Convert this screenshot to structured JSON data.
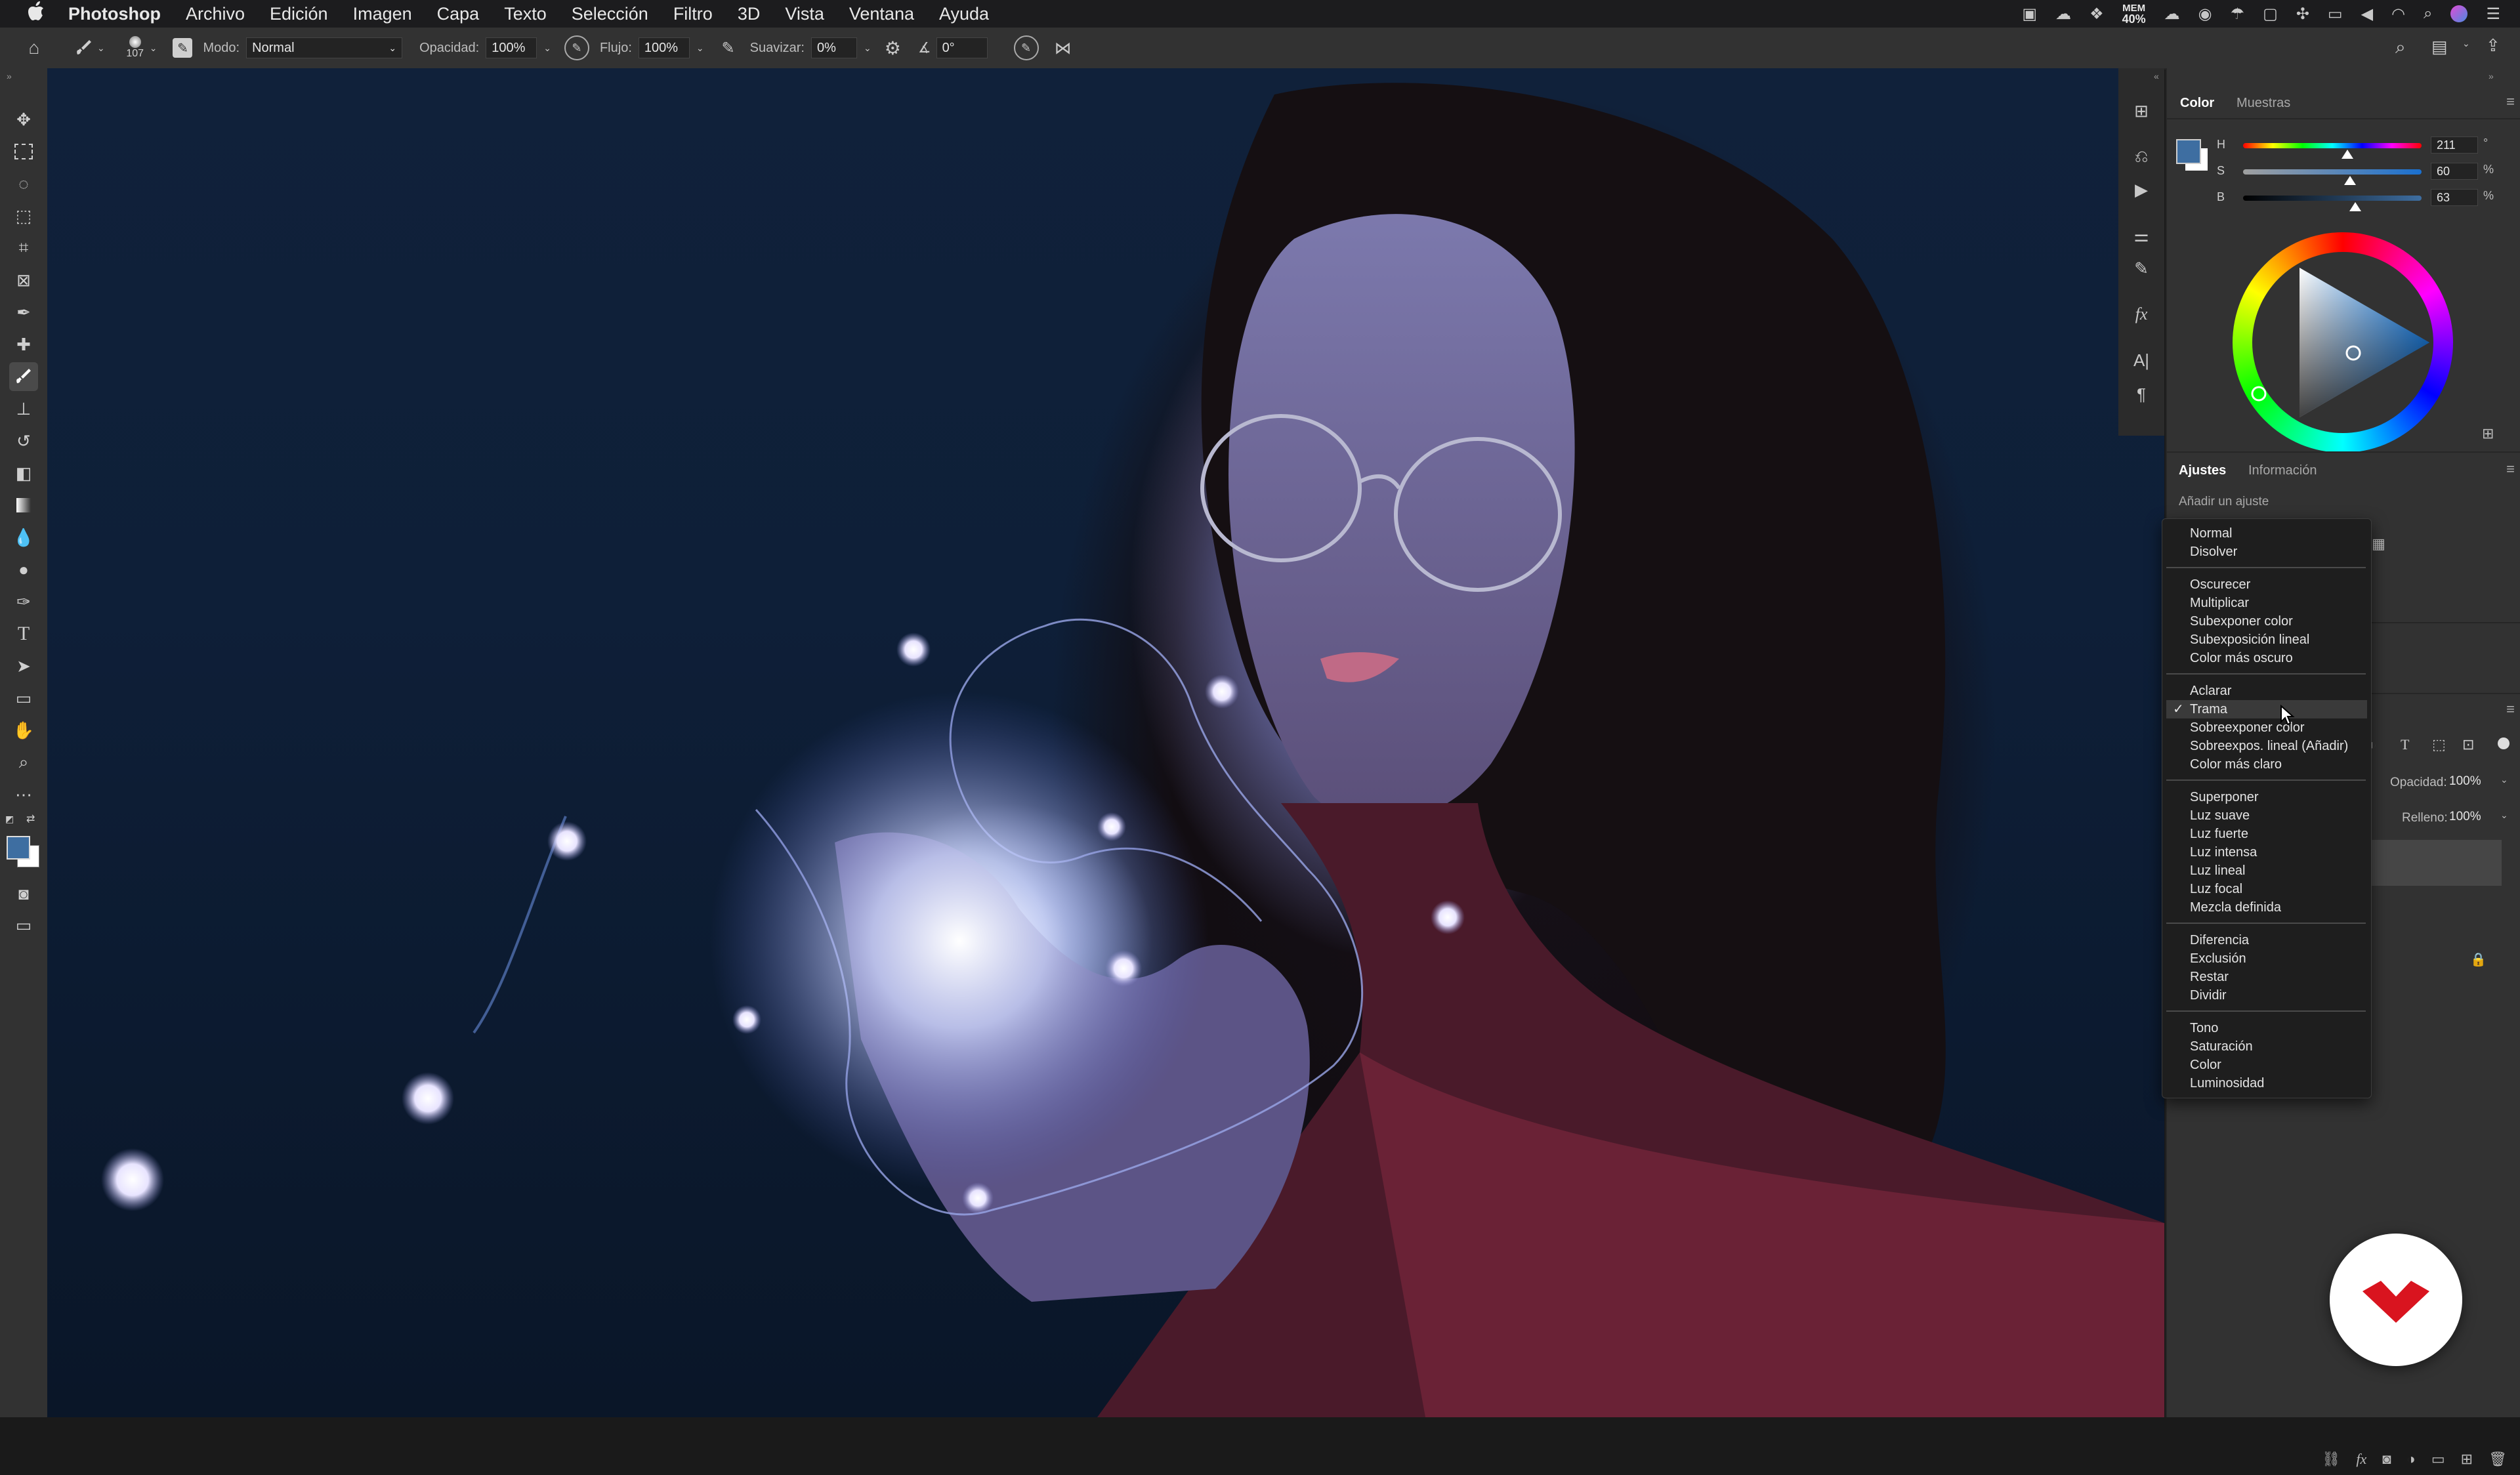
{
  "menubar": {
    "apple_icon": "apple-logo",
    "app_name": "Photoshop",
    "items": [
      "Archivo",
      "Edición",
      "Imagen",
      "Capa",
      "Texto",
      "Selección",
      "Filtro",
      "3D",
      "Vista",
      "Ventana",
      "Ayuda"
    ],
    "memory_label": "MEM",
    "memory_value": "40%"
  },
  "options_bar": {
    "brush_size": "107",
    "mode_label": "Modo:",
    "mode_value": "Normal",
    "opacity_label": "Opacidad:",
    "opacity_value": "100%",
    "flow_label": "Flujo:",
    "flow_value": "100%",
    "smoothing_label": "Suavizar:",
    "smoothing_value": "0%",
    "angle_value": "0°"
  },
  "color_panel": {
    "tab_color": "Color",
    "tab_swatches": "Muestras",
    "h_label": "H",
    "s_label": "S",
    "b_label": "B",
    "h_value": "211",
    "s_value": "60",
    "b_value": "63",
    "h_unit": "°",
    "s_unit": "%",
    "b_unit": "%",
    "foreground_color": "#3e6ea1",
    "background_color": "#ffffff",
    "h_fraction": 0.586,
    "s_fraction": 0.6,
    "b_fraction": 0.63
  },
  "adjustments_panel": {
    "tab_adjustments": "Ajustes",
    "tab_info": "Información",
    "add_adjustment": "Añadir un ajuste"
  },
  "layers_panel": {
    "opacity_label": "Opacidad:",
    "opacity_value": "100%",
    "fill_label": "Relleno:",
    "fill_value": "100%"
  },
  "blend_menu": {
    "selected": "Trama",
    "groups": [
      [
        "Normal",
        "Disolver"
      ],
      [
        "Oscurecer",
        "Multiplicar",
        "Subexponer color",
        "Subexposición lineal",
        "Color más oscuro"
      ],
      [
        "Aclarar",
        "Trama",
        "Sobreexponer color",
        "Sobreexpos. lineal (Añadir)",
        "Color más claro"
      ],
      [
        "Superponer",
        "Luz suave",
        "Luz fuerte",
        "Luz intensa",
        "Luz lineal",
        "Luz focal",
        "Mezcla definida"
      ],
      [
        "Diferencia",
        "Exclusión",
        "Restar",
        "Dividir"
      ],
      [
        "Tono",
        "Saturación",
        "Color",
        "Luminosidad"
      ]
    ]
  },
  "colors": {
    "accent": "#3e6ea1",
    "logo_red": "#d9141f"
  }
}
